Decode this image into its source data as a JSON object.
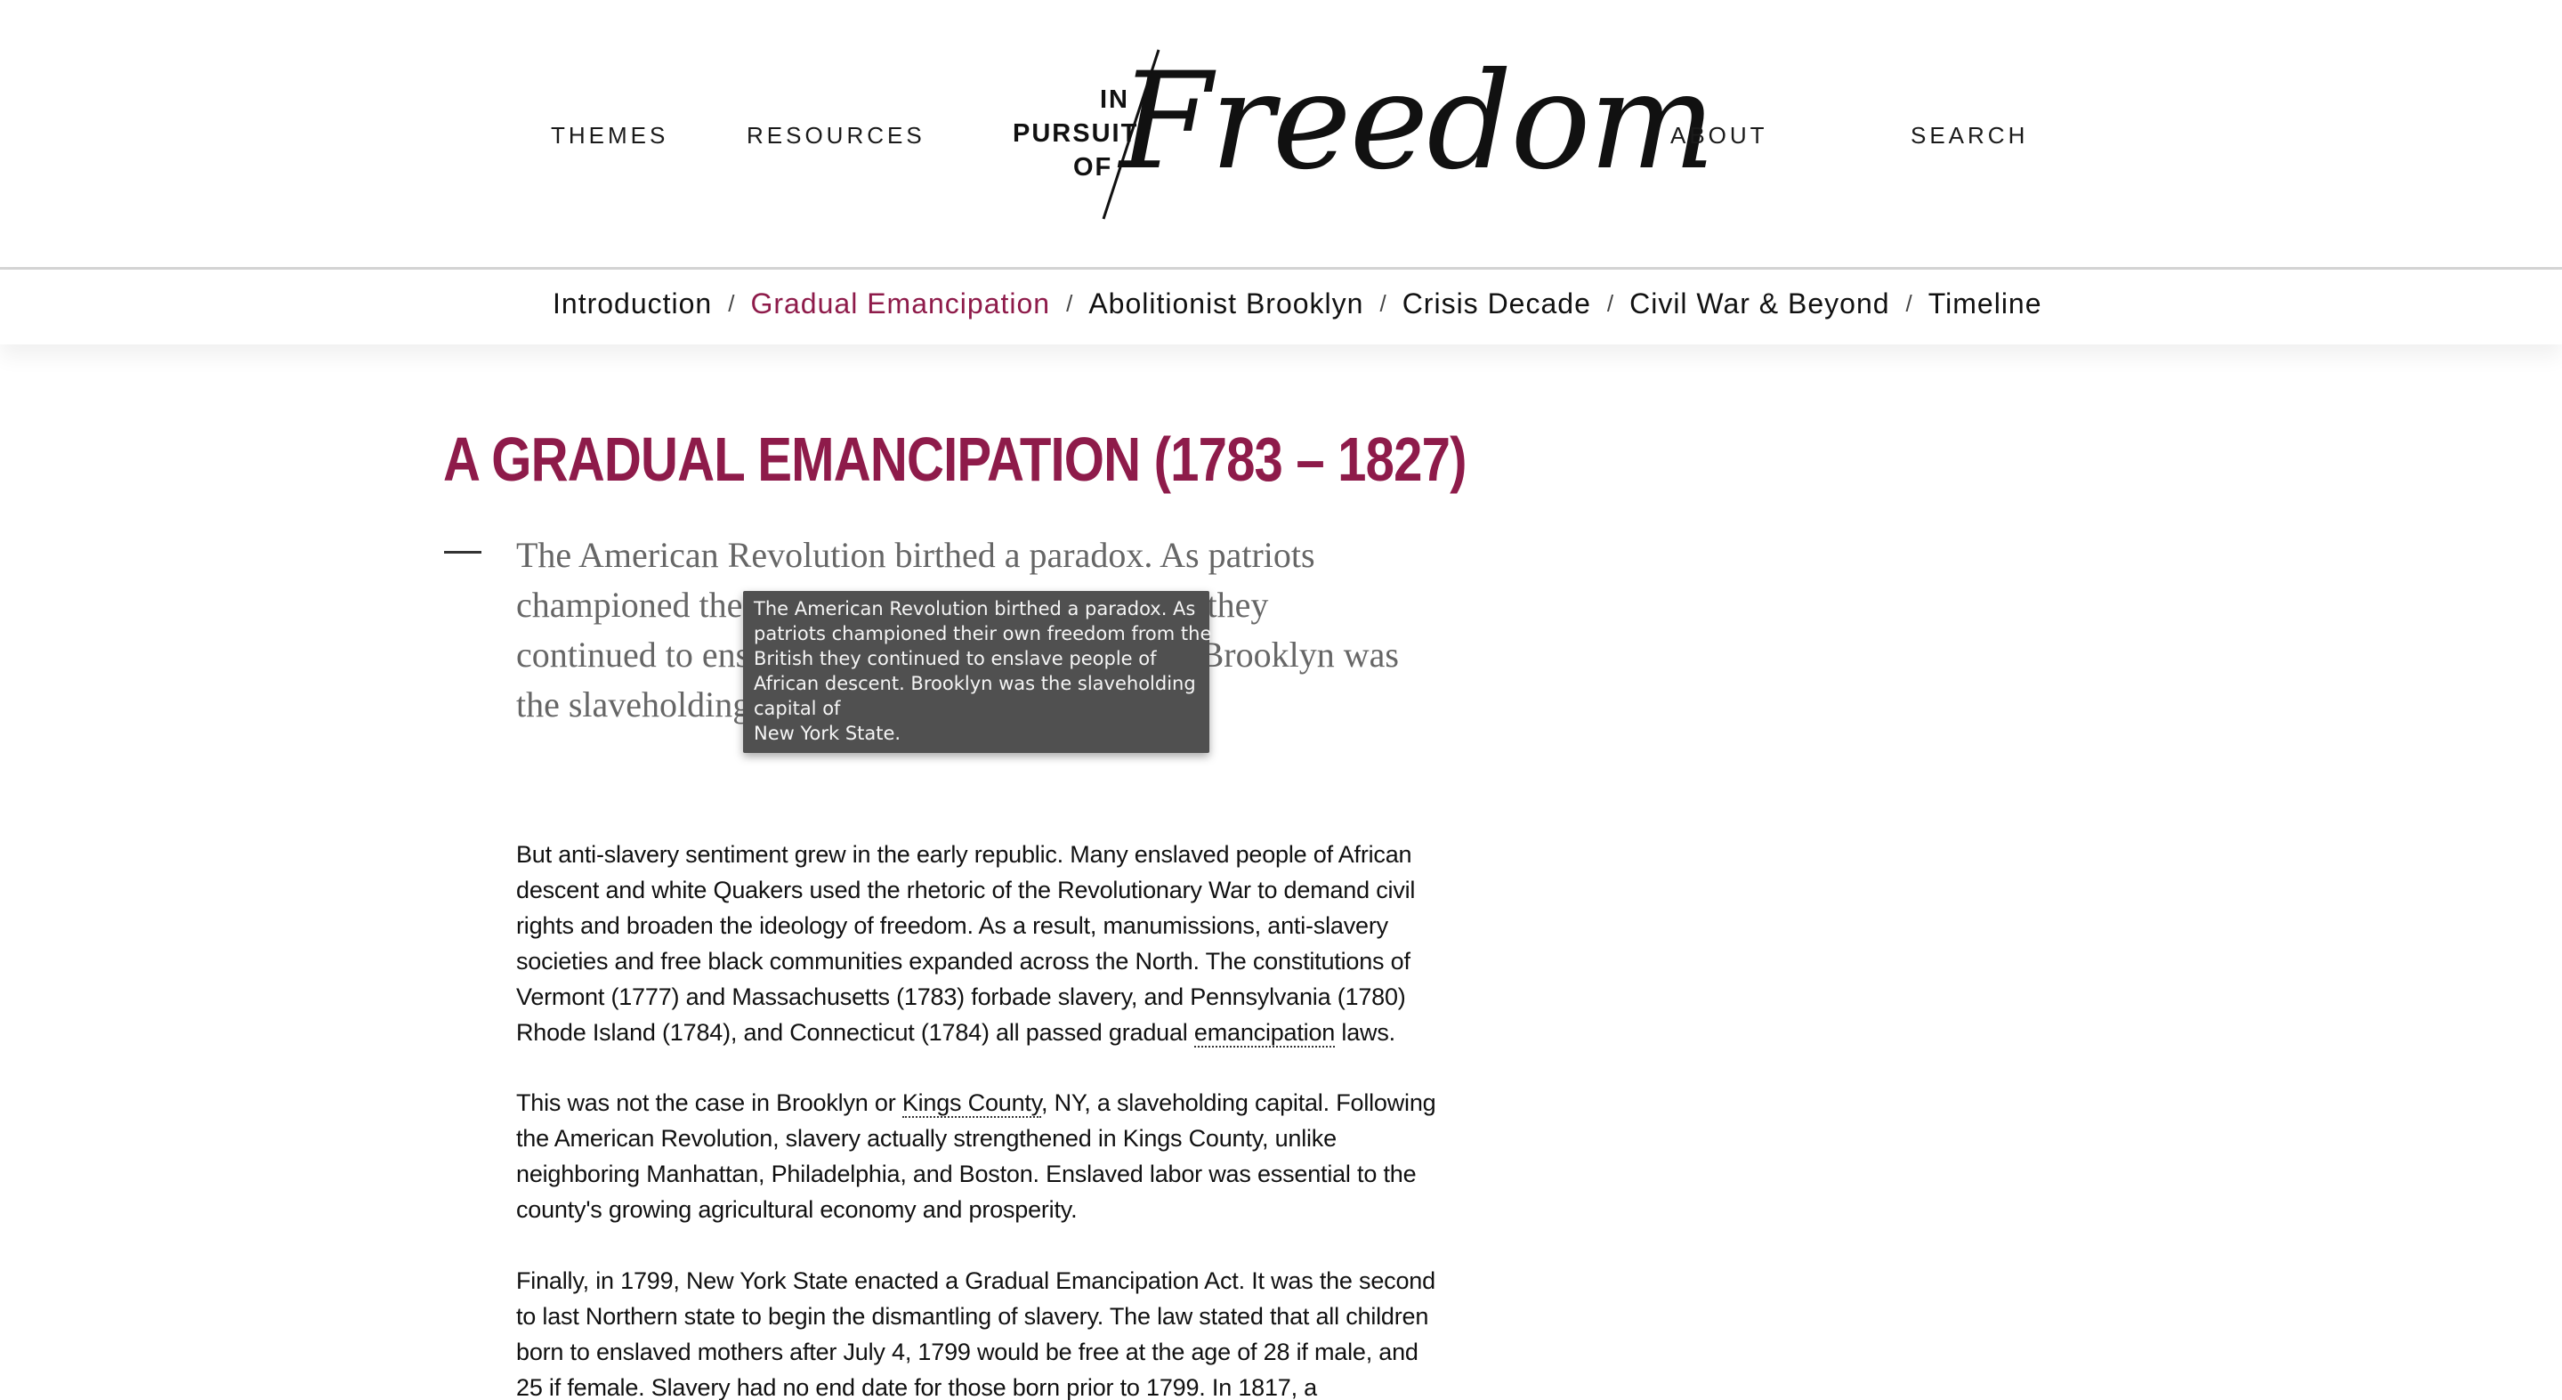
{
  "header": {
    "nav_left": [
      "THEMES",
      "RESOURCES"
    ],
    "nav_right": [
      "ABOUT",
      "SEARCH"
    ],
    "logo": {
      "small_lines": [
        "IN",
        "PURSUIT",
        "OF"
      ],
      "big": "Freedom"
    }
  },
  "subnav": {
    "items": [
      {
        "label": "Introduction"
      },
      {
        "label": "Gradual Emancipation"
      },
      {
        "label": "Abolitionist Brooklyn"
      },
      {
        "label": "Crisis Decade"
      },
      {
        "label": "Civil War & Beyond"
      },
      {
        "label": "Timeline"
      }
    ],
    "separator": "/",
    "active": "Gradual Emancipation"
  },
  "colors": {
    "accent": "#8e1b4a",
    "tooltip_bg": "#505050"
  },
  "main": {
    "title": "A GRADUAL EMANCIPATION (1783 – 1827)",
    "pull_quote": "The American Revolution birthed a paradox. As patriots championed their own freedom from the British they continued to enslave people of African descent. Brooklyn was the slaveholding capital of New York State.",
    "p1_before": "But anti-slavery sentiment grew in the early republic. Many enslaved people of African descent and white Quakers used the rhetoric of the Revolutionary War to demand civil rights and broaden the ideology of freedom. As a result, manumissions, anti-slavery societies and free black communities expanded across the North. The constitutions of Vermont (1777) and Massachusetts (1783) forbade slavery, and Pennsylvania (1780) Rhode Island (1784), and Connecticut (1784) all passed gradual ",
    "p1_term": "emancipation",
    "p1_after": " laws.",
    "p2_before": "This was not the case in Brooklyn or ",
    "p2_term": "Kings County",
    "p2_after": ", NY, a slaveholding capital. Following the American Revolution, slavery actually strengthened in Kings County, unlike neighboring Manhattan, Philadelphia, and Boston. Enslaved labor was essential to the county's growing agricultural economy and prosperity.",
    "p3": "Finally, in 1799, New York State enacted a Gradual Emancipation Act. It was the second to last Northern state to begin the dismantling of slavery. The law stated that all children born to enslaved mothers after July 4, 1799 would be free at the age of 28 if male, and 25 if female. Slavery had no end date for those born prior to 1799. In 1817, a"
  },
  "tooltip": {
    "lines": [
      "The American Revolution birthed a paradox. As",
      "patriots championed their own freedom from the",
      "British they continued to enslave people of",
      "African descent. Brooklyn was the slaveholding",
      "capital of",
      "New York State."
    ]
  }
}
